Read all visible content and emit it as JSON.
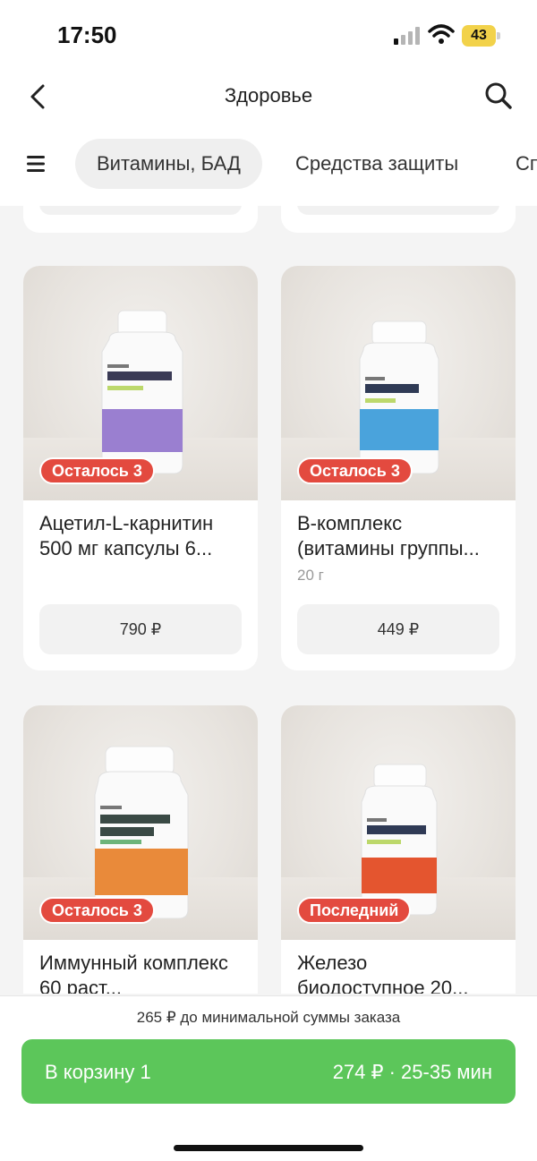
{
  "status": {
    "time": "17:50",
    "battery": "43"
  },
  "nav": {
    "title": "Здоровье"
  },
  "categories": [
    {
      "label": "Витамины, БАД",
      "active": true
    },
    {
      "label": "Средства защиты",
      "active": false
    },
    {
      "label": "Сп",
      "active": false
    }
  ],
  "products": [
    {
      "title": "Ацетил-L-карнитин 500 мг капсулы 6...",
      "weight": "",
      "price": "790 ₽",
      "badge": "Осталось 3",
      "label_color": "#9a7fd0"
    },
    {
      "title": "B-комплекс (витамины группы...",
      "weight": "20 г",
      "price": "449 ₽",
      "badge": "Осталось 3",
      "label_color": "#4aa3dc"
    },
    {
      "title": "Иммунный комплекс 60 раст...",
      "weight": "",
      "price": "",
      "badge": "Осталось 3",
      "label_color": "#e98a3a"
    },
    {
      "title": "Железо биодоступное 20...",
      "weight": "",
      "price": "",
      "badge": "Последний",
      "label_color": "#e4552f"
    }
  ],
  "bottom": {
    "min_sum": "265 ₽ до минимальной суммы заказа",
    "cart_label": "В корзину 1",
    "cart_info": "274 ₽ · 25-35 мин"
  }
}
